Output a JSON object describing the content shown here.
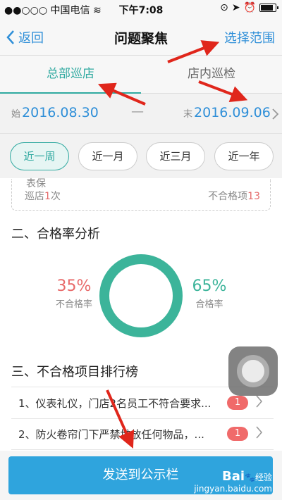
{
  "status_bar": {
    "carrier": "中国电信",
    "time": "下午7:08"
  },
  "nav": {
    "back_label": "返回",
    "title": "问题聚焦",
    "right_label": "选择范围"
  },
  "tabs": [
    {
      "label": "总部巡店",
      "active": true
    },
    {
      "label": "店内巡检",
      "active": false
    }
  ],
  "date_range": {
    "start_prefix": "始",
    "start": "2016.08.30",
    "separator": "—",
    "end_prefix": "末",
    "end": "2016.09.06"
  },
  "ranges": [
    {
      "label": "近一周",
      "selected": true
    },
    {
      "label": "近一月"
    },
    {
      "label": "近三月"
    },
    {
      "label": "近一年"
    }
  ],
  "card": {
    "cut_text": "表保",
    "visits_label": "巡店",
    "visits_value": "1",
    "visits_unit": "次",
    "fail_label": "不合格项",
    "fail_value": "13"
  },
  "pass_rate": {
    "heading": "二、合格率分析",
    "fail_pct": "35%",
    "fail_label": "不合格率",
    "pass_pct": "65%",
    "pass_label": "合格率",
    "fail_fraction": 0.35,
    "pass_fraction": 0.65,
    "colors": {
      "fail": "#e86a6a",
      "pass": "#3cb49a"
    }
  },
  "ranking": {
    "heading": "三、不合格项目排行榜",
    "items": [
      {
        "text": "1、仪表礼仪，门店2名员工不符合要求...",
        "count": "1"
      },
      {
        "text": "2、防火卷帘门下严禁堆放任何物品，...",
        "count": "1"
      }
    ]
  },
  "bottom": {
    "send_label": "发送到公示栏"
  },
  "watermark": {
    "brand": "Bai",
    "brand2": "经验",
    "url": "jingyan.baidu.com"
  },
  "colors": {
    "accent": "#2f8fd8",
    "teal": "#2fa9a0",
    "button": "#2fa4dd",
    "arrow": "#e0261b"
  }
}
